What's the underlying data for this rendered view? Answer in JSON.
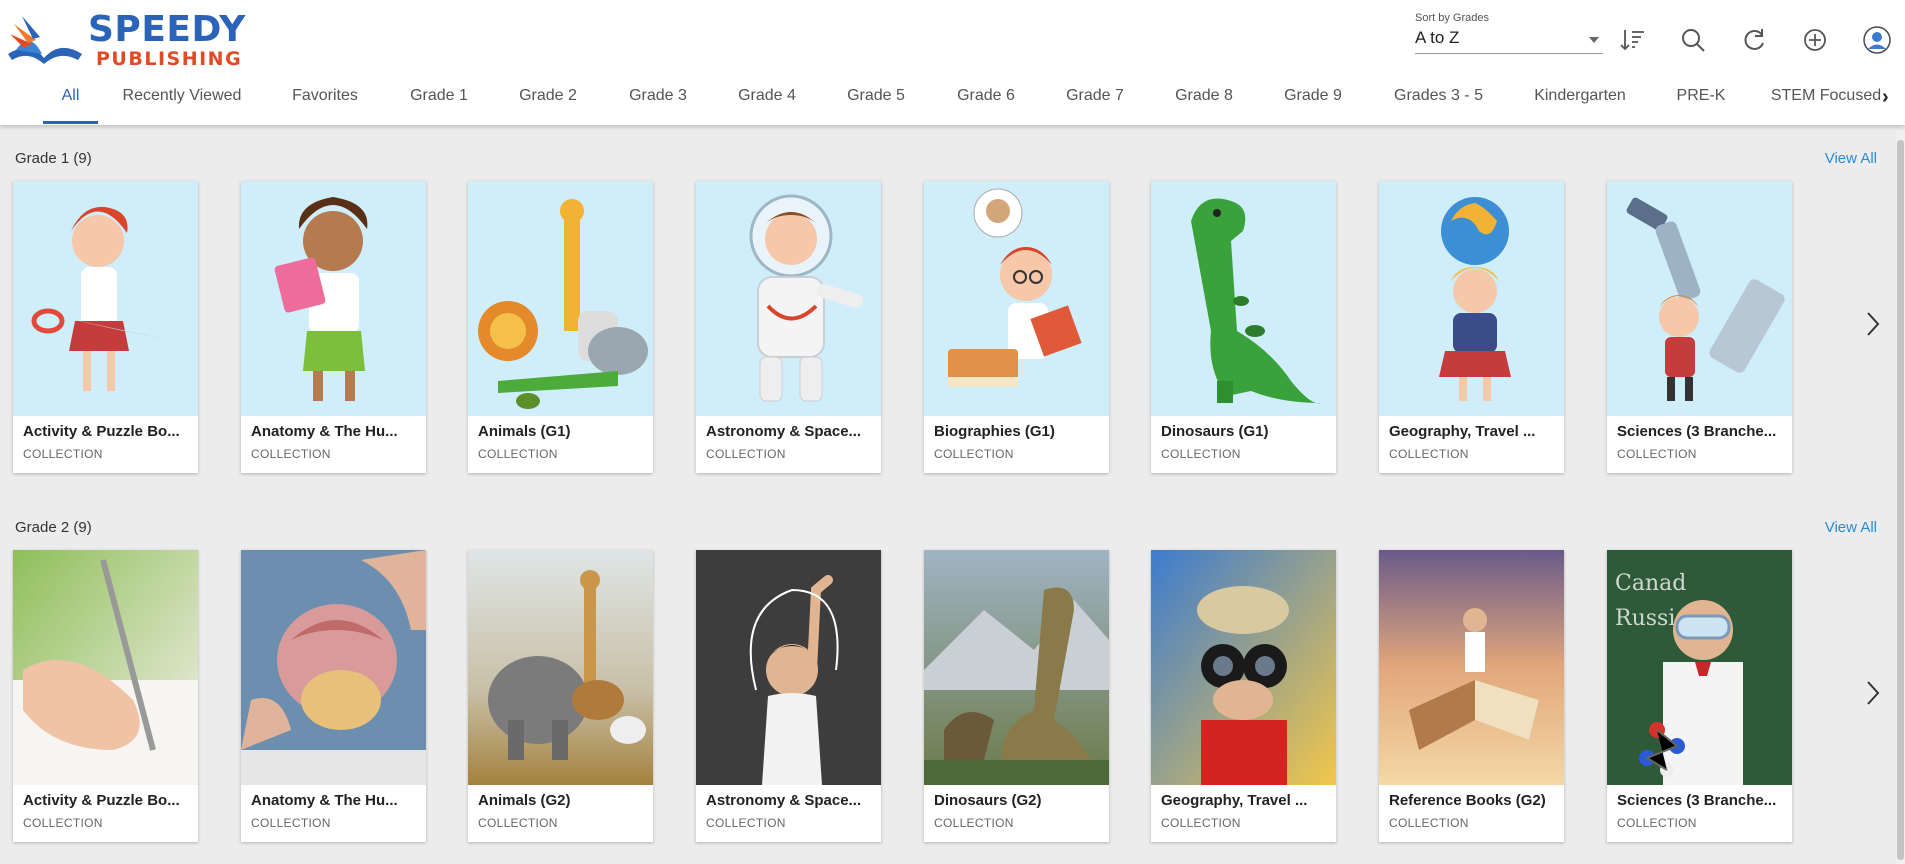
{
  "brand": {
    "line1": "SPEEDY",
    "line2": "PUBLISHING",
    "primary": "#2a63b8",
    "secondary": "#e24a26"
  },
  "sort": {
    "label": "Sort by Grades",
    "value": "A to Z"
  },
  "toolbar": {
    "icons": [
      "sort-order-icon",
      "search-icon",
      "refresh-icon",
      "add-icon",
      "account-icon"
    ]
  },
  "tabs": [
    {
      "label": "All",
      "active": true
    },
    {
      "label": "Recently Viewed"
    },
    {
      "label": "Favorites"
    },
    {
      "label": "Grade 1"
    },
    {
      "label": "Grade 2"
    },
    {
      "label": "Grade 3"
    },
    {
      "label": "Grade 4"
    },
    {
      "label": "Grade 5"
    },
    {
      "label": "Grade 6"
    },
    {
      "label": "Grade 7"
    },
    {
      "label": "Grade 8"
    },
    {
      "label": "Grade 9"
    },
    {
      "label": "Grades 3 - 5"
    },
    {
      "label": "Kindergarten"
    },
    {
      "label": "PRE-K"
    },
    {
      "label": "STEM Focused"
    }
  ],
  "sections": [
    {
      "title": "Grade 1 (9)",
      "view_all": "View All",
      "cards": [
        {
          "title": "Activity & Puzzle Bo...",
          "type": "COLLECTION"
        },
        {
          "title": "Anatomy & The Hu...",
          "type": "COLLECTION"
        },
        {
          "title": "Animals (G1)",
          "type": "COLLECTION"
        },
        {
          "title": "Astronomy & Space...",
          "type": "COLLECTION"
        },
        {
          "title": "Biographies (G1)",
          "type": "COLLECTION"
        },
        {
          "title": "Dinosaurs (G1)",
          "type": "COLLECTION"
        },
        {
          "title": "Geography, Travel ...",
          "type": "COLLECTION"
        },
        {
          "title": "Sciences (3 Branche...",
          "type": "COLLECTION"
        }
      ]
    },
    {
      "title": "Grade 2 (9)",
      "view_all": "View All",
      "cards": [
        {
          "title": "Activity & Puzzle Bo...",
          "type": "COLLECTION"
        },
        {
          "title": "Anatomy & The Hu...",
          "type": "COLLECTION"
        },
        {
          "title": "Animals (G2)",
          "type": "COLLECTION"
        },
        {
          "title": "Astronomy & Space...",
          "type": "COLLECTION"
        },
        {
          "title": "Dinosaurs (G2)",
          "type": "COLLECTION"
        },
        {
          "title": "Geography, Travel ...",
          "type": "COLLECTION"
        },
        {
          "title": "Reference Books (G2)",
          "type": "COLLECTION"
        },
        {
          "title": "Sciences (3 Branche...",
          "type": "COLLECTION"
        }
      ]
    }
  ]
}
